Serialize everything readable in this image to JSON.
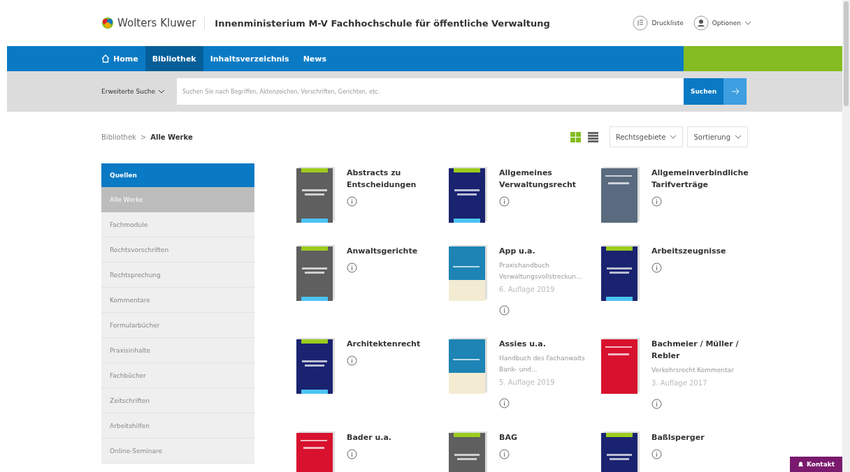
{
  "header": {
    "logo": "Wolters Kluwer",
    "title": "Innenministerium M-V Fachhochschule für öffentliche Verwaltung",
    "actions": [
      {
        "kind": "list",
        "label": "Druckliste"
      },
      {
        "kind": "user",
        "label": "Optionen"
      }
    ]
  },
  "nav": [
    {
      "label": "Home",
      "kind": "home",
      "selected": false
    },
    {
      "label": "Bibliothek",
      "kind": "text",
      "selected": true
    },
    {
      "label": "Inhaltsverzeichnis",
      "kind": "text",
      "selected": false
    },
    {
      "label": "News",
      "kind": "text",
      "selected": false
    }
  ],
  "search": {
    "mode": "Erweiterte Suche",
    "placeholder": "Suchen Sie nach Begriffen, Aktenzeichen, Vorschriften, Gerichten, etc.",
    "button": "Suchen"
  },
  "breadcrumb": {
    "items": [
      "Bibliothek",
      "Alle Werke"
    ],
    "separator": ">"
  },
  "view_modes": [
    {
      "kind": "grid",
      "selected": true
    },
    {
      "kind": "list",
      "selected": false
    }
  ],
  "filters": [
    "Rechtsgebiete",
    "Sortierung"
  ],
  "sidebar": {
    "title": "Quellen",
    "items": [
      {
        "label": "Alle Werke",
        "selected": true
      },
      {
        "label": "Fachmodule",
        "selected": false
      },
      {
        "label": "Rechtsvorschriften",
        "selected": false
      },
      {
        "label": "Rechtsprechung",
        "selected": false
      },
      {
        "label": "Kommentare",
        "selected": false
      },
      {
        "label": "Formularbücher",
        "selected": false
      },
      {
        "label": "Praxisinhalte",
        "selected": false
      },
      {
        "label": "Fachbücher",
        "selected": false
      },
      {
        "label": "Zeitschriften",
        "selected": false
      },
      {
        "label": "Arbeitshilfen",
        "selected": false
      },
      {
        "label": "Online-Seminare",
        "selected": false
      }
    ]
  },
  "books": [
    {
      "title": "Abstracts zu Entscheidungen",
      "color": "#5f5f5f",
      "kind": "series"
    },
    {
      "title": "Allgemeines Verwaltungsrecht",
      "color": "#1a2370",
      "kind": "series"
    },
    {
      "title": "Allgemeinverbindliche Tarifverträge",
      "color": "#5a6b80",
      "kind": "plain"
    },
    {
      "title": "Anwaltsgerichte",
      "color": "#5f5f5f",
      "kind": "series"
    },
    {
      "title": "App u.a.",
      "subtitle": "Praxishandbuch Verwaltungsvollstreckun...",
      "edition": "6. Auflage 2019",
      "color": "#1d84b5",
      "kind": "plain"
    },
    {
      "title": "Arbeitszeugnisse",
      "color": "#1a2370",
      "kind": "series"
    },
    {
      "title": "Architektenrecht",
      "color": "#1a2370",
      "kind": "series"
    },
    {
      "title": "Assies u.a.",
      "subtitle": "Handbuch des Fachanwalts Bank- und...",
      "edition": "5. Auflage 2019",
      "color": "#1d84b5",
      "kind": "plain"
    },
    {
      "title": "Bachmeier / Müller / Rebler",
      "subtitle": "Verkehrsrecht Kommentar",
      "edition": "3. Auflage 2017",
      "color": "#d8112e",
      "kind": "plain"
    },
    {
      "title": "Bader u.a.",
      "color": "#d8112e",
      "kind": "plain"
    },
    {
      "title": "BAG",
      "color": "#5f5f5f",
      "kind": "series"
    },
    {
      "title": "Baßlsperger",
      "color": "#1a2370",
      "kind": "series"
    }
  ],
  "contact": "Kontakt"
}
